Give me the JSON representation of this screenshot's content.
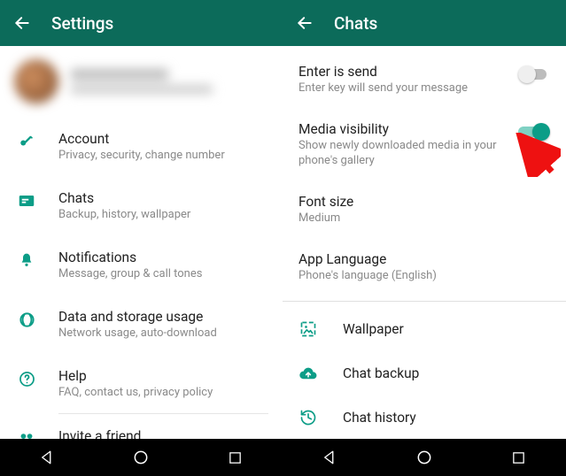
{
  "colors": {
    "primary": "#0c6b5a",
    "accent": "#0c9d87"
  },
  "left": {
    "title": "Settings",
    "items": [
      {
        "icon": "key-icon",
        "label": "Account",
        "desc": "Privacy, security, change number"
      },
      {
        "icon": "chat-icon",
        "label": "Chats",
        "desc": "Backup, history, wallpaper"
      },
      {
        "icon": "bell-icon",
        "label": "Notifications",
        "desc": "Message, group & call tones"
      },
      {
        "icon": "data-icon",
        "label": "Data and storage usage",
        "desc": "Network usage, auto-download"
      },
      {
        "icon": "help-icon",
        "label": "Help",
        "desc": "FAQ, contact us, privacy policy"
      },
      {
        "icon": "people-icon",
        "label": "Invite a friend",
        "desc": ""
      }
    ]
  },
  "right": {
    "title": "Chats",
    "settings": [
      {
        "label": "Enter is send",
        "desc": "Enter key will send your message",
        "toggle": false
      },
      {
        "label": "Media visibility",
        "desc": "Show newly downloaded media in your phone's gallery",
        "toggle": true
      },
      {
        "label": "Font size",
        "desc": "Medium"
      },
      {
        "label": "App Language",
        "desc": "Phone's language (English)"
      }
    ],
    "iconRows": [
      {
        "icon": "wallpaper-icon",
        "label": "Wallpaper"
      },
      {
        "icon": "cloud-up-icon",
        "label": "Chat backup"
      },
      {
        "icon": "history-icon",
        "label": "Chat history"
      }
    ]
  }
}
